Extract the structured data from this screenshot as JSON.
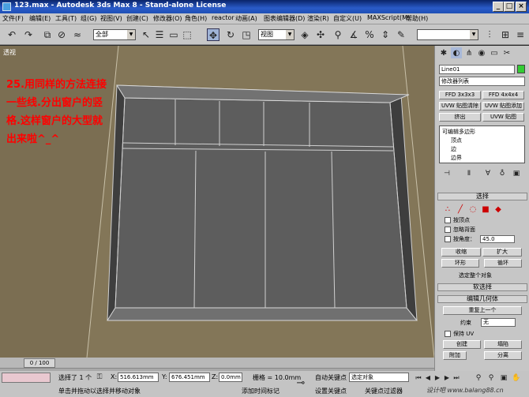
{
  "window": {
    "title": "123.max - Autodesk 3ds Max 8 - Stand-alone License",
    "minimize": "_",
    "maximize": "□",
    "close": "×"
  },
  "menu": [
    "文件(F)",
    "编辑(E)",
    "工具(T)",
    "组(G)",
    "视图(V)",
    "创建(C)",
    "修改器(O)",
    "角色(H)",
    "reactor",
    "动画(A)",
    "图表编辑器(D)",
    "渲染(R)",
    "自定义(U)",
    "MAXScript(M)",
    "帮助(H)"
  ],
  "toolbar": {
    "selection_filter": "全部",
    "ref_coord": "视图"
  },
  "viewport": {
    "label": "透视",
    "note": "25.用同样的方法连接一些线.分出窗户的竖格.这样窗户的大型就出来啦^_^"
  },
  "command_panel": {
    "object_name": "Line01",
    "object_color": "#33cc33",
    "modifier_list": "修改器列表",
    "buttons": [
      "FFD 3x3x3",
      "FFD 4x4x4",
      "UVW 贴图清除",
      "UVW 贴图添加",
      "挤出",
      "UVW 贴图"
    ],
    "stack": {
      "root": "可编辑多边形",
      "items": [
        "顶点",
        "边",
        "边界"
      ]
    },
    "selection_title": "选择",
    "by_vertex": "按顶点",
    "ignore_backfacing": "忽略背面",
    "by_angle": "按角度：",
    "angle_value": "45.0",
    "shrink": "收缩",
    "grow": "扩大",
    "ring": "环形",
    "loop": "循环",
    "selected_info": "选定整个对象",
    "soft_selection": "软选择",
    "edit_geometry": "编辑几何体",
    "repeat_last": "重复上一个",
    "constraints": "约束",
    "constraints_value": "无",
    "preserve_uvs": "保持 UV",
    "create": "创建",
    "collapse": "塌陷",
    "attach": "附加",
    "detach": "分离"
  },
  "timeline": {
    "position": "0 / 100"
  },
  "status": {
    "selected": "选择了 1 个",
    "prompt": "单击并拖动以选择并移动对象",
    "x_label": "X:",
    "x_value": "516.613mm",
    "y_label": "Y:",
    "y_value": "676.451mm",
    "z_label": "Z:",
    "z_value": "0.0mm",
    "grid": "栅格 = 10.0mm",
    "add_time_tag": "添加时间标记",
    "auto_key": "自动关键点",
    "set_key": "设置关键点",
    "selected_obj": "选定对象",
    "key_filters": "关键点过滤器"
  },
  "watermark": "设计吧 www.balang88.cn"
}
